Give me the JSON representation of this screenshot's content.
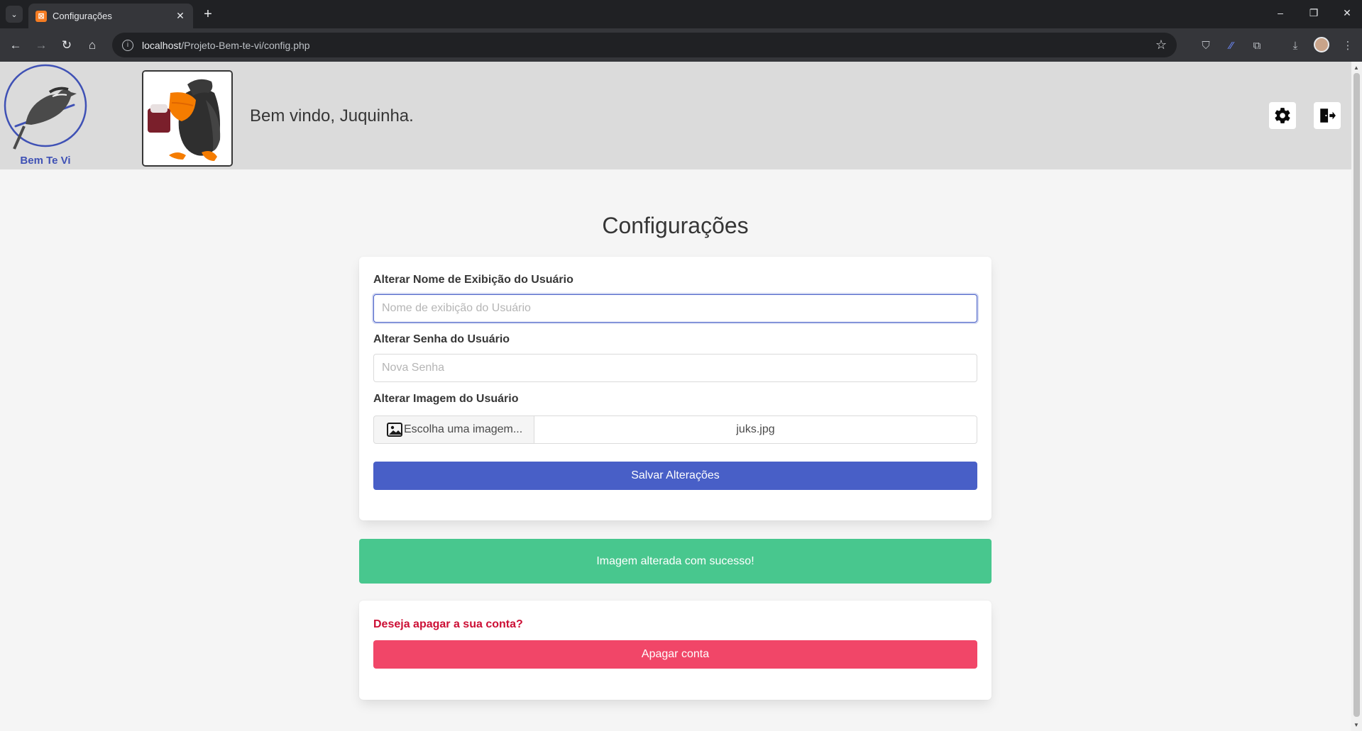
{
  "browser": {
    "tab_title": "Configurações",
    "url_host": "localhost",
    "url_path": "/Projeto-Bem-te-vi/config.php"
  },
  "header": {
    "logo_text": "Bem Te Vi",
    "welcome": "Bem vindo, Juquinha."
  },
  "page": {
    "title": "Configurações"
  },
  "form": {
    "name_label": "Alterar Nome de Exibição do Usuário",
    "name_placeholder": "Nome de exibição do Usuário",
    "name_value": "",
    "password_label": "Alterar Senha do Usuário",
    "password_placeholder": "Nova Senha",
    "password_value": "",
    "image_label": "Alterar Imagem do Usuário",
    "image_button": "Escolha uma imagem...",
    "image_filename": "juks.jpg",
    "save_button": "Salvar Alterações"
  },
  "notification": {
    "message": "Imagem alterada com sucesso!"
  },
  "danger": {
    "question": "Deseja apagar a sua conta?",
    "delete_button": "Apagar conta"
  },
  "colors": {
    "primary": "#485fc7",
    "success": "#48c78e",
    "danger": "#f14668",
    "header_bg": "#dbdbdb"
  }
}
